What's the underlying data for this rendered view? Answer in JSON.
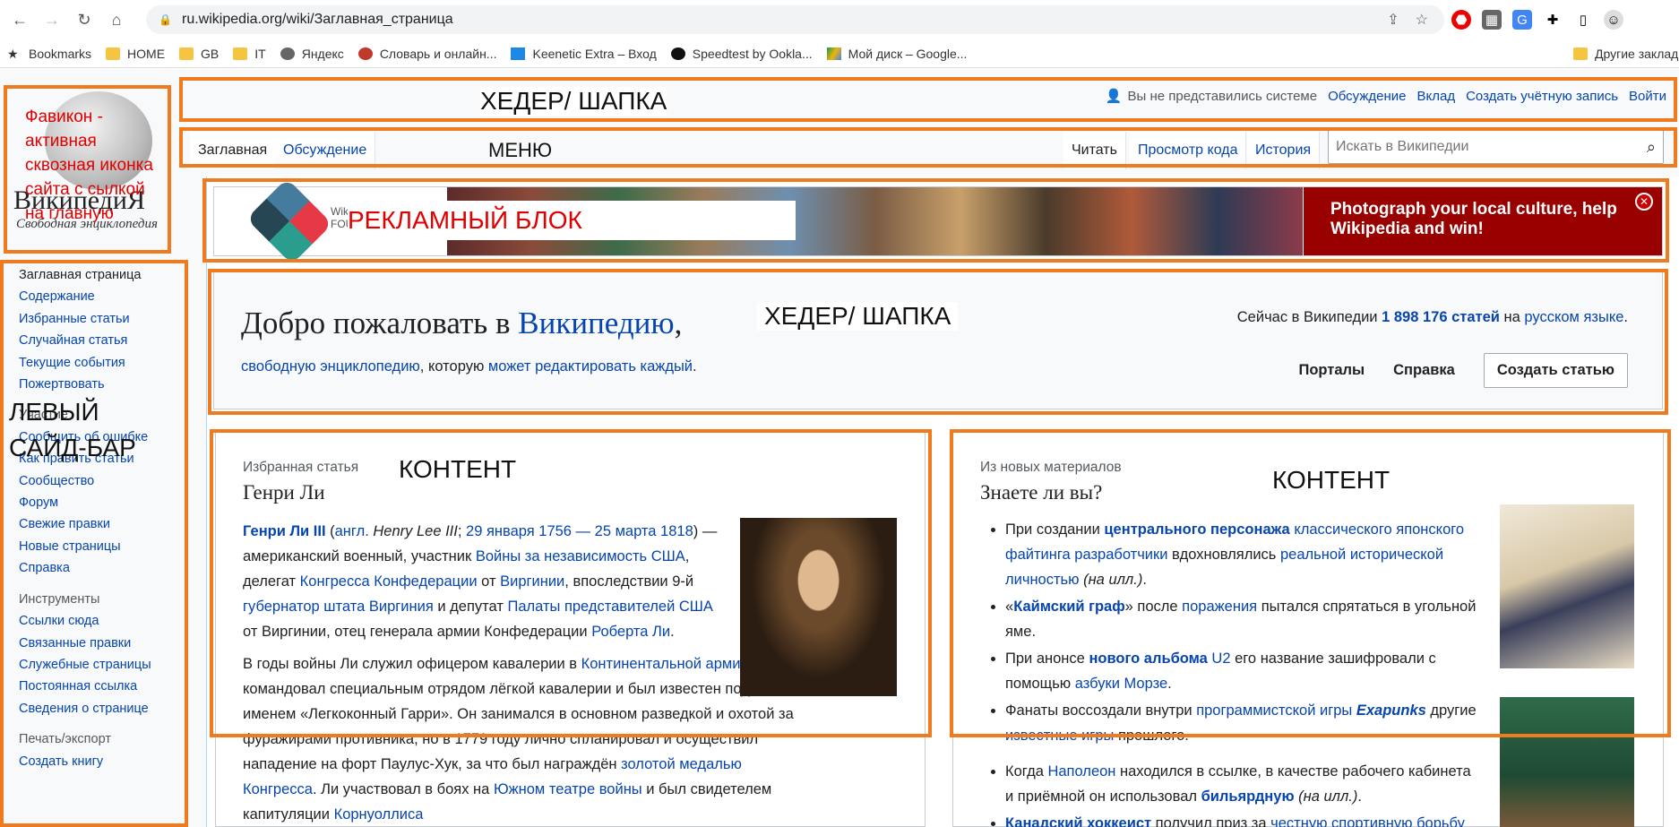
{
  "browser": {
    "url": "ru.wikipedia.org/wiki/Заглавная_страница",
    "bookmarks": [
      "Bookmarks",
      "HOME",
      "GB",
      "IT",
      "Яндекс",
      "Словарь и онлайн...",
      "Keenetic Extra – Вход",
      "Speedtest by Ookla...",
      "Мой диск – Google...",
      "Другие заклад"
    ]
  },
  "logo": {
    "title": "ВикипедиЯ",
    "subtitle": "Свободная энциклопедия",
    "note": "Фавикон - активная сквозная иконка сайта с сылкой на главную"
  },
  "personal": {
    "not_logged": "Вы не представились системе",
    "links": [
      "Обсуждение",
      "Вклад",
      "Создать учётную запись",
      "Войти"
    ]
  },
  "tabs": {
    "left": [
      "Заглавная",
      "Обсуждение"
    ],
    "right": [
      "Читать",
      "Просмотр кода",
      "История"
    ]
  },
  "search": {
    "placeholder": "Искать в Википедии"
  },
  "sidebar": {
    "nav": [
      "Заглавная страница",
      "Содержание",
      "Избранные статьи",
      "Случайная статья",
      "Текущие события",
      "Пожертвовать"
    ],
    "participate_head": "Участие",
    "participate": [
      "Сообщить об ошибке",
      "Как править статьи",
      "Сообщество",
      "Форум",
      "Свежие правки",
      "Новые страницы",
      "Справка"
    ],
    "tools_head": "Инструменты",
    "tools": [
      "Ссылки сюда",
      "Связанные правки",
      "Служебные страницы",
      "Постоянная ссылка",
      "Сведения о странице"
    ],
    "print_head": "Печать/экспорт",
    "print": [
      "Создать книгу"
    ]
  },
  "banner": {
    "org_line1": "Wiki",
    "org_line2": "FOU",
    "cta": "Photograph your local culture, help Wikipedia and win!"
  },
  "welcome": {
    "title_prefix": "Добро пожаловать в ",
    "title_link": "Википедию",
    "title_suffix": ",",
    "tag_link1": "свободную энциклопедию",
    "tag_mid": ", которую ",
    "tag_link2": "может редактировать каждый",
    "tag_end": ".",
    "stats_prefix": "Сейчас в Википедии ",
    "stats_count": "1 898 176 статей",
    "stats_mid": " на ",
    "stats_lang": "русском языке",
    "stats_end": ".",
    "btn_portals": "Порталы",
    "btn_help": "Справка",
    "btn_create": "Создать статью"
  },
  "featured": {
    "kicker": "Избранная статья",
    "title": "Генри Ли",
    "p1_name": "Генри Ли III",
    "p1_a": " (",
    "p1_lang": "англ.",
    "p1_b": " ",
    "p1_orig": "Henry Lee III",
    "p1_c": "; ",
    "p1_dates": "29 января 1756 — 25 марта 1818",
    "p1_d": ") — американский военный, участник ",
    "p1_war": "Войны за независимость США",
    "p1_e": ", делегат ",
    "p1_congress": "Конгресса Конфедерации",
    "p1_f": " от ",
    "p1_virginia": "Виргинии",
    "p1_g": ", впоследствии 9-й ",
    "p1_gov": "губернатор штата Виргиния",
    "p1_h": " и депутат ",
    "p1_house": "Палаты представителей США",
    "p1_i": " от Виргинии, отец генерала армии Конфедерации ",
    "p1_robert": "Роберта Ли",
    "p1_j": ".",
    "p2_a": "В годы войны Ли служил офицером кавалерии в ",
    "p2_army": "Континентальной армии",
    "p2_b": ", командовал специальным отрядом лёгкой кавалерии и был известен под именем «Легкоконный Гарри». Он занимался в основном разведкой и охотой за фуражирами противника, но в 1779 году лично спланировал и осуществил нападение на форт Паулус-Хук, за что был награждён ",
    "p2_medal": "золотой медалью Конгресса",
    "p2_c": ". Ли участвовал в боях на ",
    "p2_south": "Южном театре войны",
    "p2_d": " и был свидетелем капитуляции ",
    "p2_corn": "Корнуоллиса"
  },
  "dyk": {
    "kicker": "Из новых материалов",
    "title": "Знаете ли вы?",
    "i1_a": "При создании ",
    "i1_char": "центрального персонажа",
    "i1_b": " ",
    "i1_game": "классического японского файтинга",
    "i1_c": " ",
    "i1_dev": "разработчики",
    "i1_d": " вдохновлялись ",
    "i1_real": "реальной исторической личностью",
    "i1_e": " ",
    "i1_ill": "(на илл.)",
    "i1_f": ".",
    "i2_a": "«",
    "i2_count": "Каймский граф",
    "i2_b": "» после ",
    "i2_def": "поражения",
    "i2_c": " пытался спрятаться в угольной яме.",
    "i3_a": "При анонсе ",
    "i3_album": "нового альбома",
    "i3_b": " ",
    "i3_u2": "U2",
    "i3_c": " его название зашифровали с помощью ",
    "i3_morse": "азбуки Морзе",
    "i3_d": ".",
    "i4_a": "Фанаты воссоздали внутри ",
    "i4_prog": "программистской игры",
    "i4_b": " ",
    "i4_exa": "Exapunks",
    "i4_c": " другие ",
    "i4_known": "известные игры",
    "i4_d": " прошлого.",
    "i5_a": "Когда ",
    "i5_nap": "Наполеон",
    "i5_b": " находился в ссылке, в качестве рабочего кабинета и приёмной он использовал ",
    "i5_bil": "бильярдную",
    "i5_c": " ",
    "i5_ill": "(на илл.)",
    "i5_d": ".",
    "i6_a": "Канадский хоккеист",
    "i6_b": " получил приз за ",
    "i6_fair": "честную спортивную борьбу"
  },
  "annotations": {
    "header": "ХЕДЕР/ ШАПКА",
    "menu": "МЕНЮ",
    "ads": "РЕКЛАМНЫЙ БЛОК",
    "header2": "ХЕДЕР/ ШАПКА",
    "sidebar": "ЛЕВЫЙ САЙД-БАР",
    "content1": "КОНТЕНТ",
    "content2": "КОНТЕНТ"
  },
  "colors": {
    "link": "#0645ad",
    "annotation": "#f07a1e",
    "banner_cta": "#990000"
  }
}
